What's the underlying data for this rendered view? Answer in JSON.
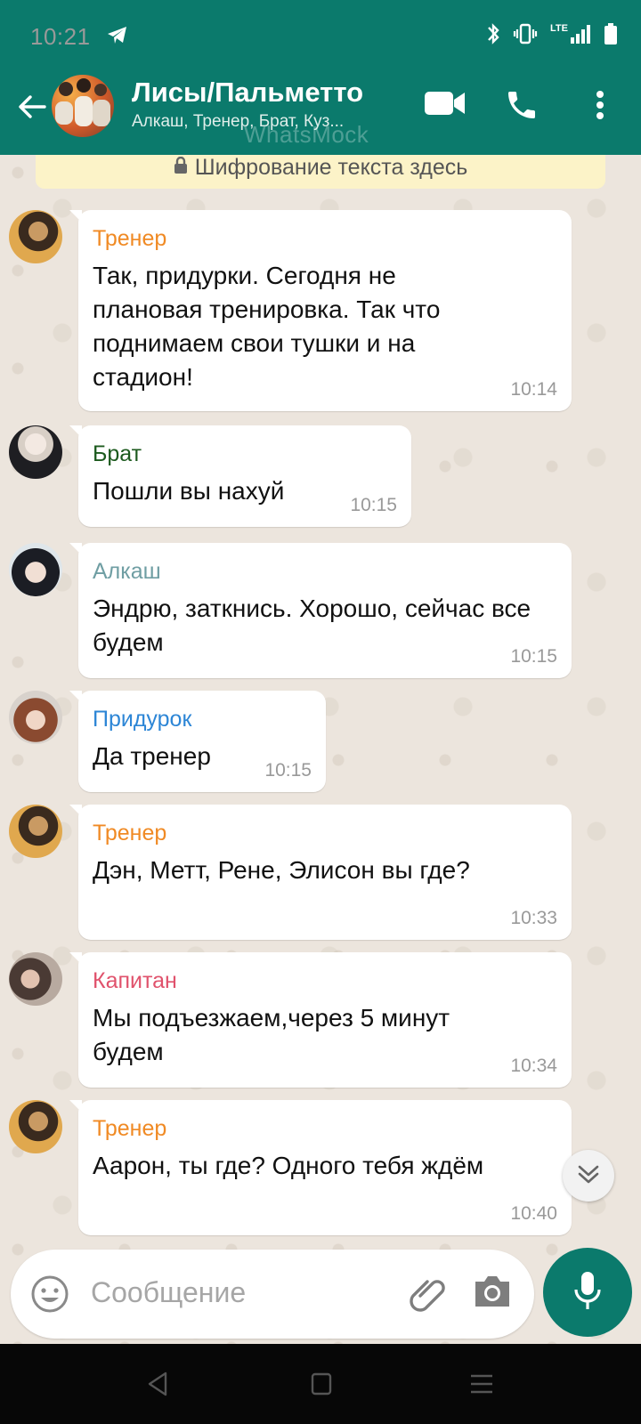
{
  "status_bar": {
    "time": "10:21",
    "network": "LTE"
  },
  "header": {
    "title": "Лисы/Пальметто",
    "subtitle": "Алкаш, Тренер, Брат, Куз...",
    "watermark": "WhatsMock"
  },
  "encryption_notice": "Шифрование текста здесь",
  "messages": [
    {
      "sender": "Тренер",
      "sender_color": "#f08a24",
      "text": "Так, придурки. Сегодня не плановая тренировка. Так что поднимаем свои тушки и на стадион!",
      "time": "10:14"
    },
    {
      "sender": "Брат",
      "sender_color": "#1c5a1e",
      "text": "Пошли вы нахуй",
      "time": "10:15"
    },
    {
      "sender": "Алкаш",
      "sender_color": "#6f9ea3",
      "text": "Эндрю, заткнись. Хорошо, сейчас все будем",
      "time": "10:15"
    },
    {
      "sender": "Придурок",
      "sender_color": "#2d86d6",
      "text": "Да тренер",
      "time": "10:15"
    },
    {
      "sender": "Тренер",
      "sender_color": "#f08a24",
      "text": "Дэн, Метт, Рене, Элисон вы где?",
      "time": "10:33"
    },
    {
      "sender": "Капитан",
      "sender_color": "#e0526c",
      "text": "Мы подъезжаем,через 5 минут будем",
      "time": "10:34"
    },
    {
      "sender": "Тренер",
      "sender_color": "#f08a24",
      "text": "Аарон, ты где? Одного тебя ждём",
      "time": "10:40"
    }
  ],
  "composer": {
    "placeholder": "Сообщение"
  },
  "icons": {
    "back": "arrow-left-icon",
    "video": "video-call-icon",
    "call": "phone-icon",
    "menu": "more-vert-icon",
    "emoji": "emoji-icon",
    "attach": "paperclip-icon",
    "camera": "camera-icon",
    "mic": "microphone-icon",
    "scroll": "chevron-double-down-icon",
    "lock": "lock-icon"
  },
  "colors": {
    "primary": "#0b7a6c",
    "chat_bg": "#ece5dd",
    "bubble": "#ffffff",
    "notice_bg": "#fcf3c8"
  }
}
